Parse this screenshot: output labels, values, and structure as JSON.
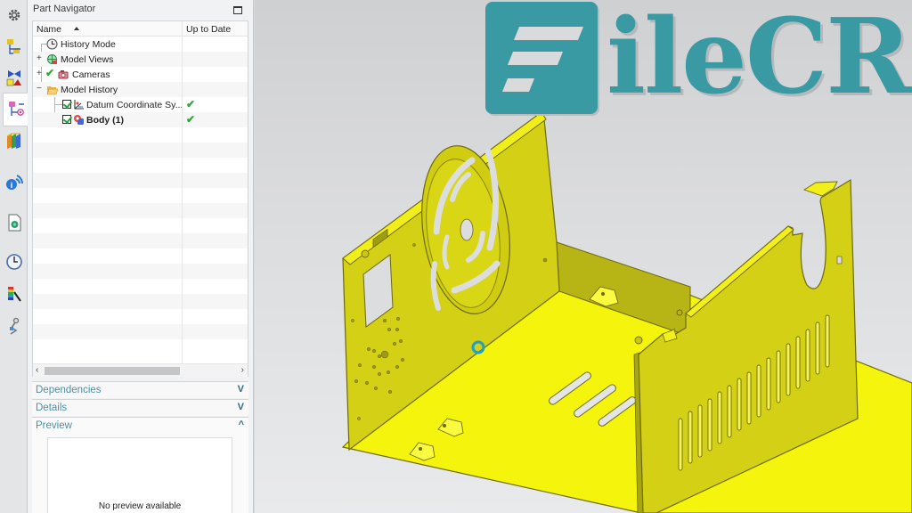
{
  "resource_bar": {
    "items": [
      {
        "name": "roles-gear-icon",
        "active": false
      },
      {
        "name": "assembly-navigator-icon",
        "active": false
      },
      {
        "name": "constraint-navigator-icon",
        "active": false
      },
      {
        "name": "part-navigator-icon",
        "active": true
      },
      {
        "name": "reuse-library-icon",
        "active": false
      },
      {
        "name": "hd3d-tools-icon",
        "active": false
      },
      {
        "name": "web-browser-icon",
        "active": false
      },
      {
        "name": "history-icon",
        "active": false
      },
      {
        "name": "visualization-palette-icon",
        "active": false
      },
      {
        "name": "process-studio-icon",
        "active": false
      }
    ]
  },
  "part_navigator": {
    "title": "Part Navigator",
    "columns": {
      "name": "Name",
      "up_to_date": "Up to Date"
    },
    "rows": [
      {
        "label": "History Mode",
        "icon": "clock-icon",
        "expander": "",
        "checked": null,
        "bold": false,
        "up_to_date": ""
      },
      {
        "label": "Model Views",
        "icon": "model-views-icon",
        "expander": "+",
        "checked": null,
        "bold": false,
        "up_to_date": ""
      },
      {
        "label": "Cameras",
        "icon": "camera-icon",
        "expander": "+",
        "checked": "green-check",
        "bold": false,
        "up_to_date": ""
      },
      {
        "label": "Model History",
        "icon": "folder-open-icon",
        "expander": "−",
        "checked": null,
        "bold": false,
        "up_to_date": ""
      },
      {
        "label": "Datum Coordinate Sy...",
        "icon": "datum-csys-icon",
        "expander": "",
        "checked": "checkbox",
        "bold": false,
        "up_to_date": "✔"
      },
      {
        "label": "Body (1)",
        "icon": "body-icon",
        "expander": "",
        "checked": "checkbox",
        "bold": true,
        "up_to_date": "✔"
      }
    ],
    "scroll": {
      "left": "‹",
      "right": "›"
    },
    "sections": [
      {
        "label": "Dependencies",
        "state": "collapsed",
        "chevron": "V"
      },
      {
        "label": "Details",
        "state": "collapsed",
        "chevron": "V"
      },
      {
        "label": "Preview",
        "state": "expanded",
        "chevron": "^"
      }
    ],
    "preview_text": "No preview available"
  },
  "graphics": {
    "model": "sheet-metal-chassis",
    "model_color": "#f2f20a",
    "background_top": "#cfd0d2",
    "background_bottom": "#e9eaeb"
  },
  "watermark": {
    "text": "ileCR",
    "brand_color": "#3a9aa3"
  }
}
